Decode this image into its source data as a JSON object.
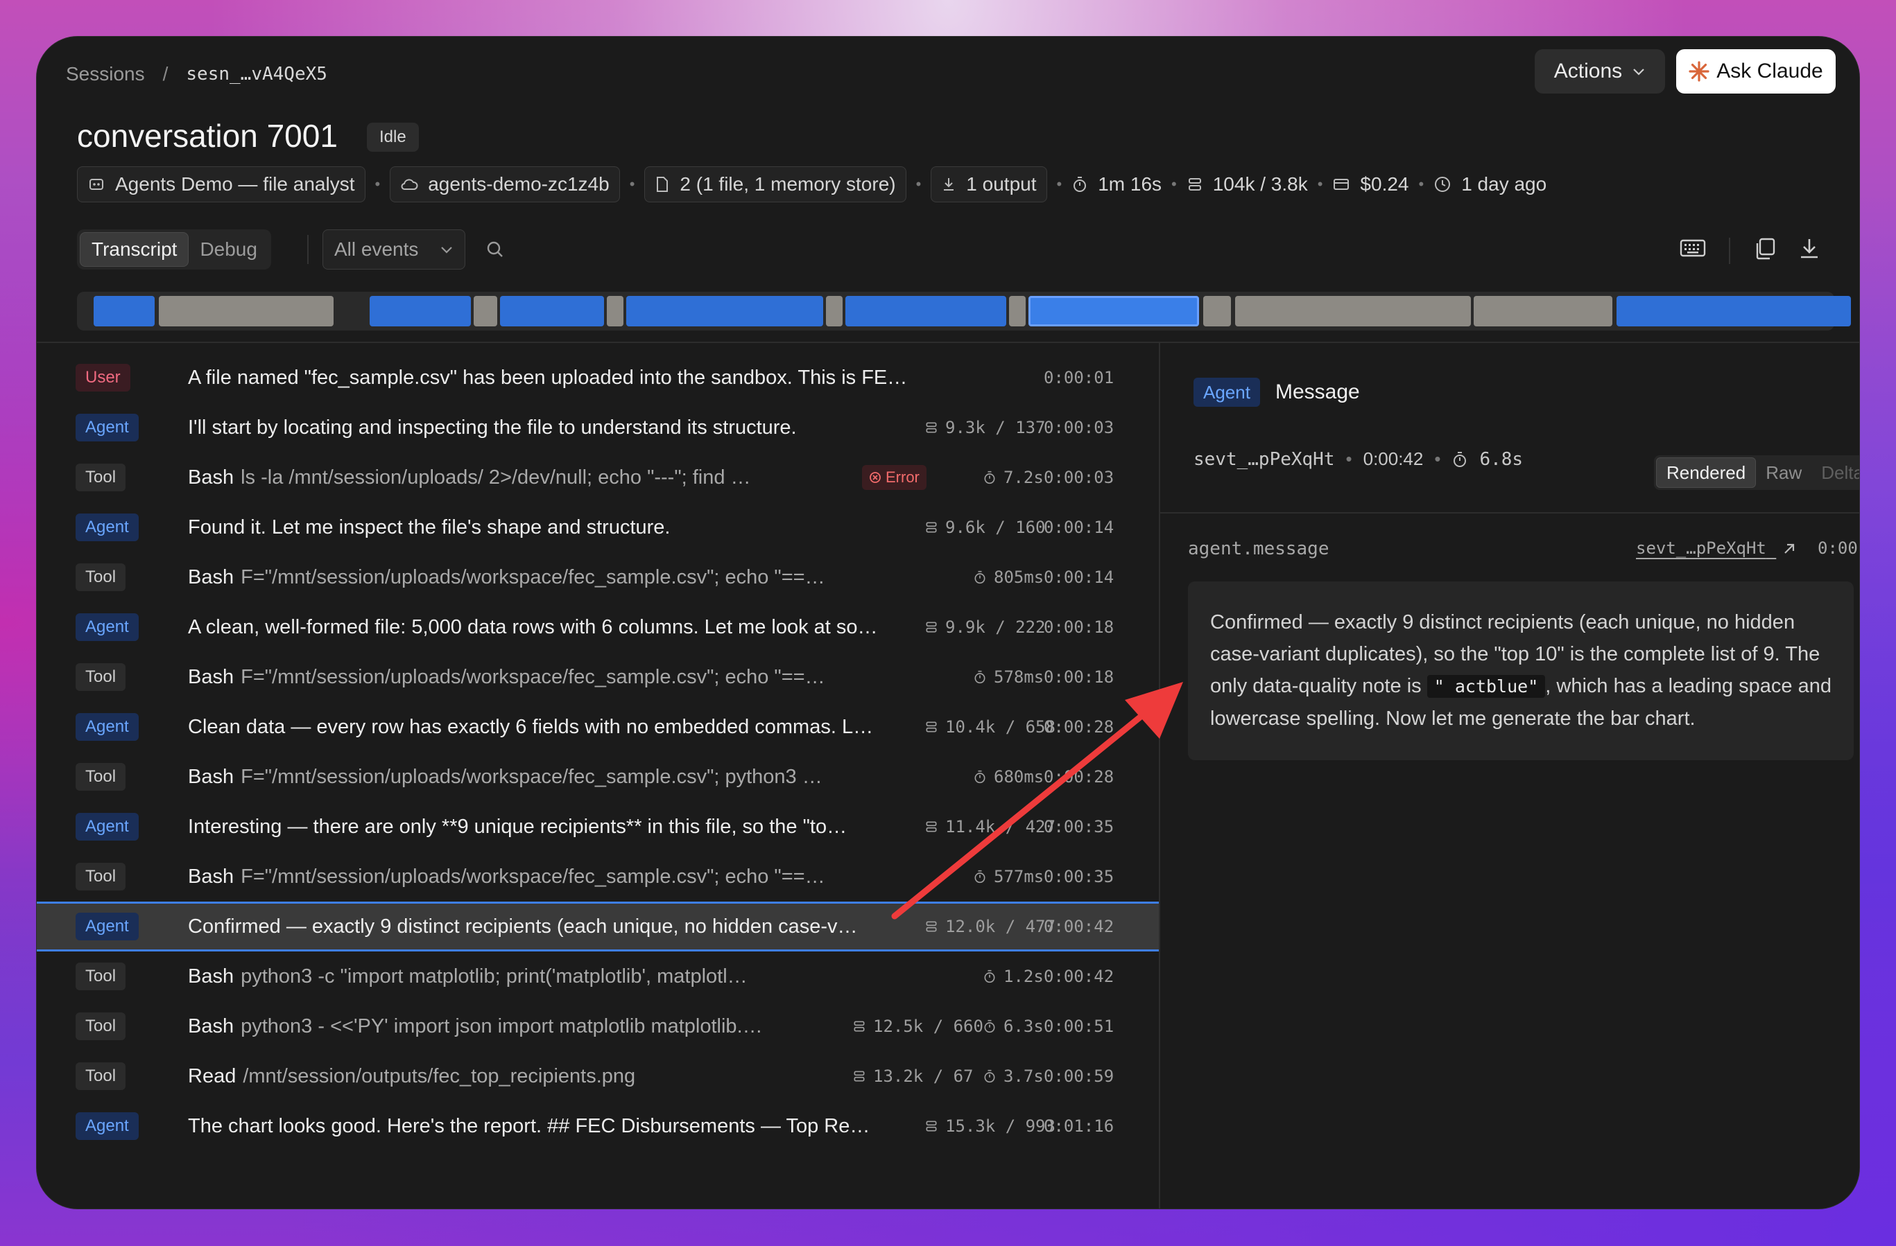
{
  "breadcrumb": {
    "root": "Sessions",
    "separator": "/",
    "session_id": "sesn_…vA4QeX5"
  },
  "header": {
    "actions_label": "Actions",
    "ask_label": "Ask Claude"
  },
  "session": {
    "title": "conversation 7001",
    "status": "Idle",
    "agent": "Agents Demo — file analyst",
    "environment": "agents-demo-zc1z4b",
    "files": "2 (1 file, 1 memory store)",
    "outputs": "1 output",
    "duration": "1m 16s",
    "tokens": "104k / 3.8k",
    "cost": "$0.24",
    "age": "1 day ago"
  },
  "tabs": {
    "transcript": "Transcript",
    "debug": "Debug",
    "active": "Transcript"
  },
  "filter": {
    "value": "All events"
  },
  "timeline": {
    "segments": [
      {
        "kind": "blue"
      },
      {
        "kind": "gray"
      },
      {
        "kind": "blue"
      },
      {
        "kind": "gray"
      },
      {
        "kind": "blue"
      },
      {
        "kind": "gray"
      },
      {
        "kind": "blue"
      },
      {
        "kind": "gray"
      },
      {
        "kind": "blue"
      },
      {
        "kind": "gray"
      },
      {
        "kind": "blue",
        "selected": true
      },
      {
        "kind": "gray"
      },
      {
        "kind": "gray"
      },
      {
        "kind": "gray"
      },
      {
        "kind": "blue"
      }
    ]
  },
  "events": [
    {
      "role": "User",
      "text": "A file named \"fec_sample.csv\" has been uploaded into the sandbox. This is FEC ca…",
      "cmd": "",
      "tokens": "",
      "duration": "",
      "error": "",
      "time": "0:00:01"
    },
    {
      "role": "Agent",
      "text": "I'll start by locating and inspecting the file to understand its structure.",
      "cmd": "",
      "tokens": "9.3k / 137",
      "duration": "",
      "error": "",
      "time": "0:00:03"
    },
    {
      "role": "Tool",
      "text": "Bash",
      "cmd": "ls -la /mnt/session/uploads/ 2>/dev/null; echo \"---\"; find …",
      "tokens": "",
      "duration": "7.2s",
      "error": "Error",
      "time": "0:00:03"
    },
    {
      "role": "Agent",
      "text": "Found it. Let me inspect the file's shape and structure.",
      "cmd": "",
      "tokens": "9.6k / 160",
      "duration": "",
      "error": "",
      "time": "0:00:14"
    },
    {
      "role": "Tool",
      "text": "Bash",
      "cmd": "F=\"/mnt/session/uploads/workspace/fec_sample.csv\"; echo \"==…",
      "tokens": "",
      "duration": "805ms",
      "error": "",
      "time": "0:00:14"
    },
    {
      "role": "Agent",
      "text": "A clean, well-formed file: 5,000 data rows with 6 columns. Let me look at so…",
      "cmd": "",
      "tokens": "9.9k / 222",
      "duration": "",
      "error": "",
      "time": "0:00:18"
    },
    {
      "role": "Tool",
      "text": "Bash",
      "cmd": "F=\"/mnt/session/uploads/workspace/fec_sample.csv\"; echo \"==…",
      "tokens": "",
      "duration": "578ms",
      "error": "",
      "time": "0:00:18"
    },
    {
      "role": "Agent",
      "text": "Clean data — every row has exactly 6 fields with no embedded commas. L…",
      "cmd": "",
      "tokens": "10.4k / 658",
      "duration": "",
      "error": "",
      "time": "0:00:28"
    },
    {
      "role": "Tool",
      "text": "Bash",
      "cmd": "F=\"/mnt/session/uploads/workspace/fec_sample.csv\"; python3 …",
      "tokens": "",
      "duration": "680ms",
      "error": "",
      "time": "0:00:28"
    },
    {
      "role": "Agent",
      "text": "Interesting — there are only **9 unique recipients** in this file, so the \"to…",
      "cmd": "",
      "tokens": "11.4k / 427",
      "duration": "",
      "error": "",
      "time": "0:00:35"
    },
    {
      "role": "Tool",
      "text": "Bash",
      "cmd": "F=\"/mnt/session/uploads/workspace/fec_sample.csv\"; echo \"==…",
      "tokens": "",
      "duration": "577ms",
      "error": "",
      "time": "0:00:35"
    },
    {
      "role": "Agent",
      "text": "Confirmed — exactly 9 distinct recipients (each unique, no hidden case-v…",
      "cmd": "",
      "tokens": "12.0k / 477",
      "duration": "",
      "error": "",
      "time": "0:00:42",
      "selected": true
    },
    {
      "role": "Tool",
      "text": "Bash",
      "cmd": "python3 -c \"import matplotlib; print('matplotlib', matplotl…",
      "tokens": "",
      "duration": "1.2s",
      "error": "",
      "time": "0:00:42"
    },
    {
      "role": "Tool",
      "text": "Bash",
      "cmd": "python3 - <<'PY' import json import matplotlib matplotlib.…",
      "tokens": "12.5k / 660",
      "duration": "6.3s",
      "error": "",
      "time": "0:00:51"
    },
    {
      "role": "Tool",
      "text": "Read",
      "cmd": "/mnt/session/outputs/fec_top_recipients.png",
      "tokens": "13.2k / 67",
      "duration": "3.7s",
      "error": "",
      "time": "0:00:59"
    },
    {
      "role": "Agent",
      "text": "The chart looks good. Here's the report. ## FEC Disbursements — Top Re…",
      "cmd": "",
      "tokens": "15.3k / 993",
      "duration": "",
      "error": "",
      "time": "0:01:16"
    }
  ],
  "detail": {
    "role": "Agent",
    "title": "Message",
    "event_id": "sevt_…pPeXqHt",
    "time": "0:00:42",
    "duration": "6.8s",
    "views": [
      "Rendered",
      "Raw",
      "Deltas"
    ],
    "active_view": "Rendered",
    "event_type": "agent.message",
    "message_before": "Confirmed — exactly 9 distinct recipients (each unique, no hidden case-variant duplicates), so the \"top 10\" is the complete list of 9. The only data-quality note is ",
    "message_code": "\" actblue\"",
    "message_after": ", which has a leading space and lowercase spelling. Now let me generate the bar chart."
  },
  "colors": {
    "agent_badge": "#6aa6ff",
    "user_badge": "#f06a80",
    "error": "#f26b6b",
    "timeline_blue": "#2f6fd6",
    "timeline_gray": "#8d8a84",
    "annotation_arrow": "#ee3b3b"
  }
}
